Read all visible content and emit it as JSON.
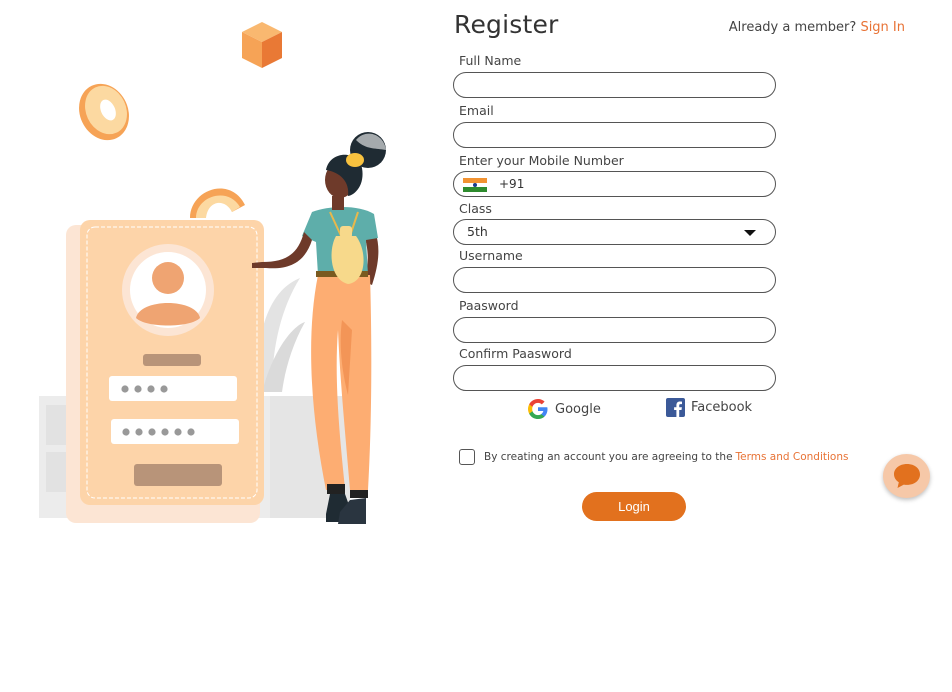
{
  "page": {
    "title": "Register",
    "member_prompt": "Already a member?",
    "sign_in_label": "Sign In"
  },
  "form": {
    "full_name": {
      "label": "Full Name",
      "value": ""
    },
    "email": {
      "label": "Email",
      "value": ""
    },
    "mobile": {
      "label": "Enter your Mobile Number",
      "country_code": "+91",
      "flag": "india-flag-icon",
      "value": ""
    },
    "class": {
      "label": "Class",
      "selected": "5th"
    },
    "username": {
      "label": "Username",
      "value": ""
    },
    "password": {
      "label": "Paasword",
      "value": ""
    },
    "confirm_password": {
      "label": "Confirm Paasword",
      "value": ""
    }
  },
  "social": {
    "google_label": "Google",
    "facebook_label": "Facebook",
    "google_icon": "google-icon",
    "facebook_icon": "facebook-icon"
  },
  "terms": {
    "text": "By creating an account you are agreeing to the",
    "link_label": "Terms and Conditions"
  },
  "submit": {
    "label": "Login"
  },
  "chat": {
    "icon": "chat-bubble-icon"
  },
  "colors": {
    "accent": "#E2711E",
    "link": "#E87336",
    "chat_bg": "#F6C8A8",
    "illustration_card": "#FDD4A9",
    "illustration_pants": "#FDAD72",
    "illustration_shirt": "#5EAEAA"
  }
}
